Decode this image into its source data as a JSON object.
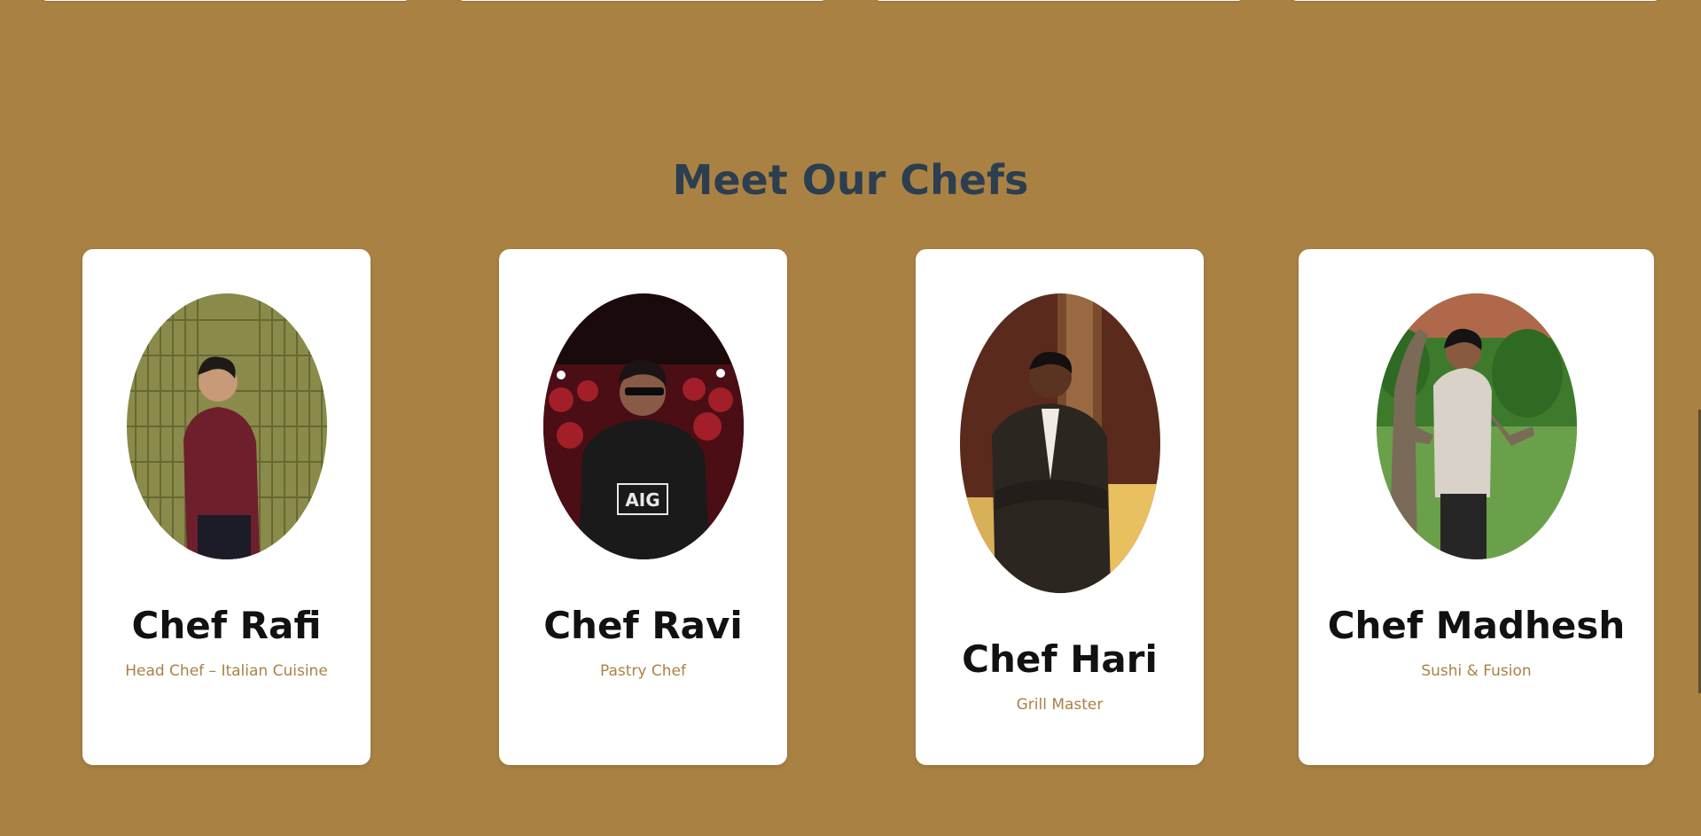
{
  "section": {
    "title": "Meet Our Chefs"
  },
  "chefs": [
    {
      "name": "Chef Rafi",
      "role": "Head Chef – Italian Cuisine",
      "photo_icon": "chef-rafi-photo"
    },
    {
      "name": "Chef Ravi",
      "role": "Pastry Chef",
      "photo_icon": "chef-ravi-photo"
    },
    {
      "name": "Chef Hari",
      "role": "Grill Master",
      "photo_icon": "chef-hari-photo"
    },
    {
      "name": "Chef Madhesh",
      "role": "Sushi & Fusion",
      "photo_icon": "chef-madhesh-photo"
    }
  ],
  "colors": {
    "background": "#a98243",
    "title": "#2c3e50",
    "role_text": "#a98243",
    "card": "#ffffff"
  }
}
